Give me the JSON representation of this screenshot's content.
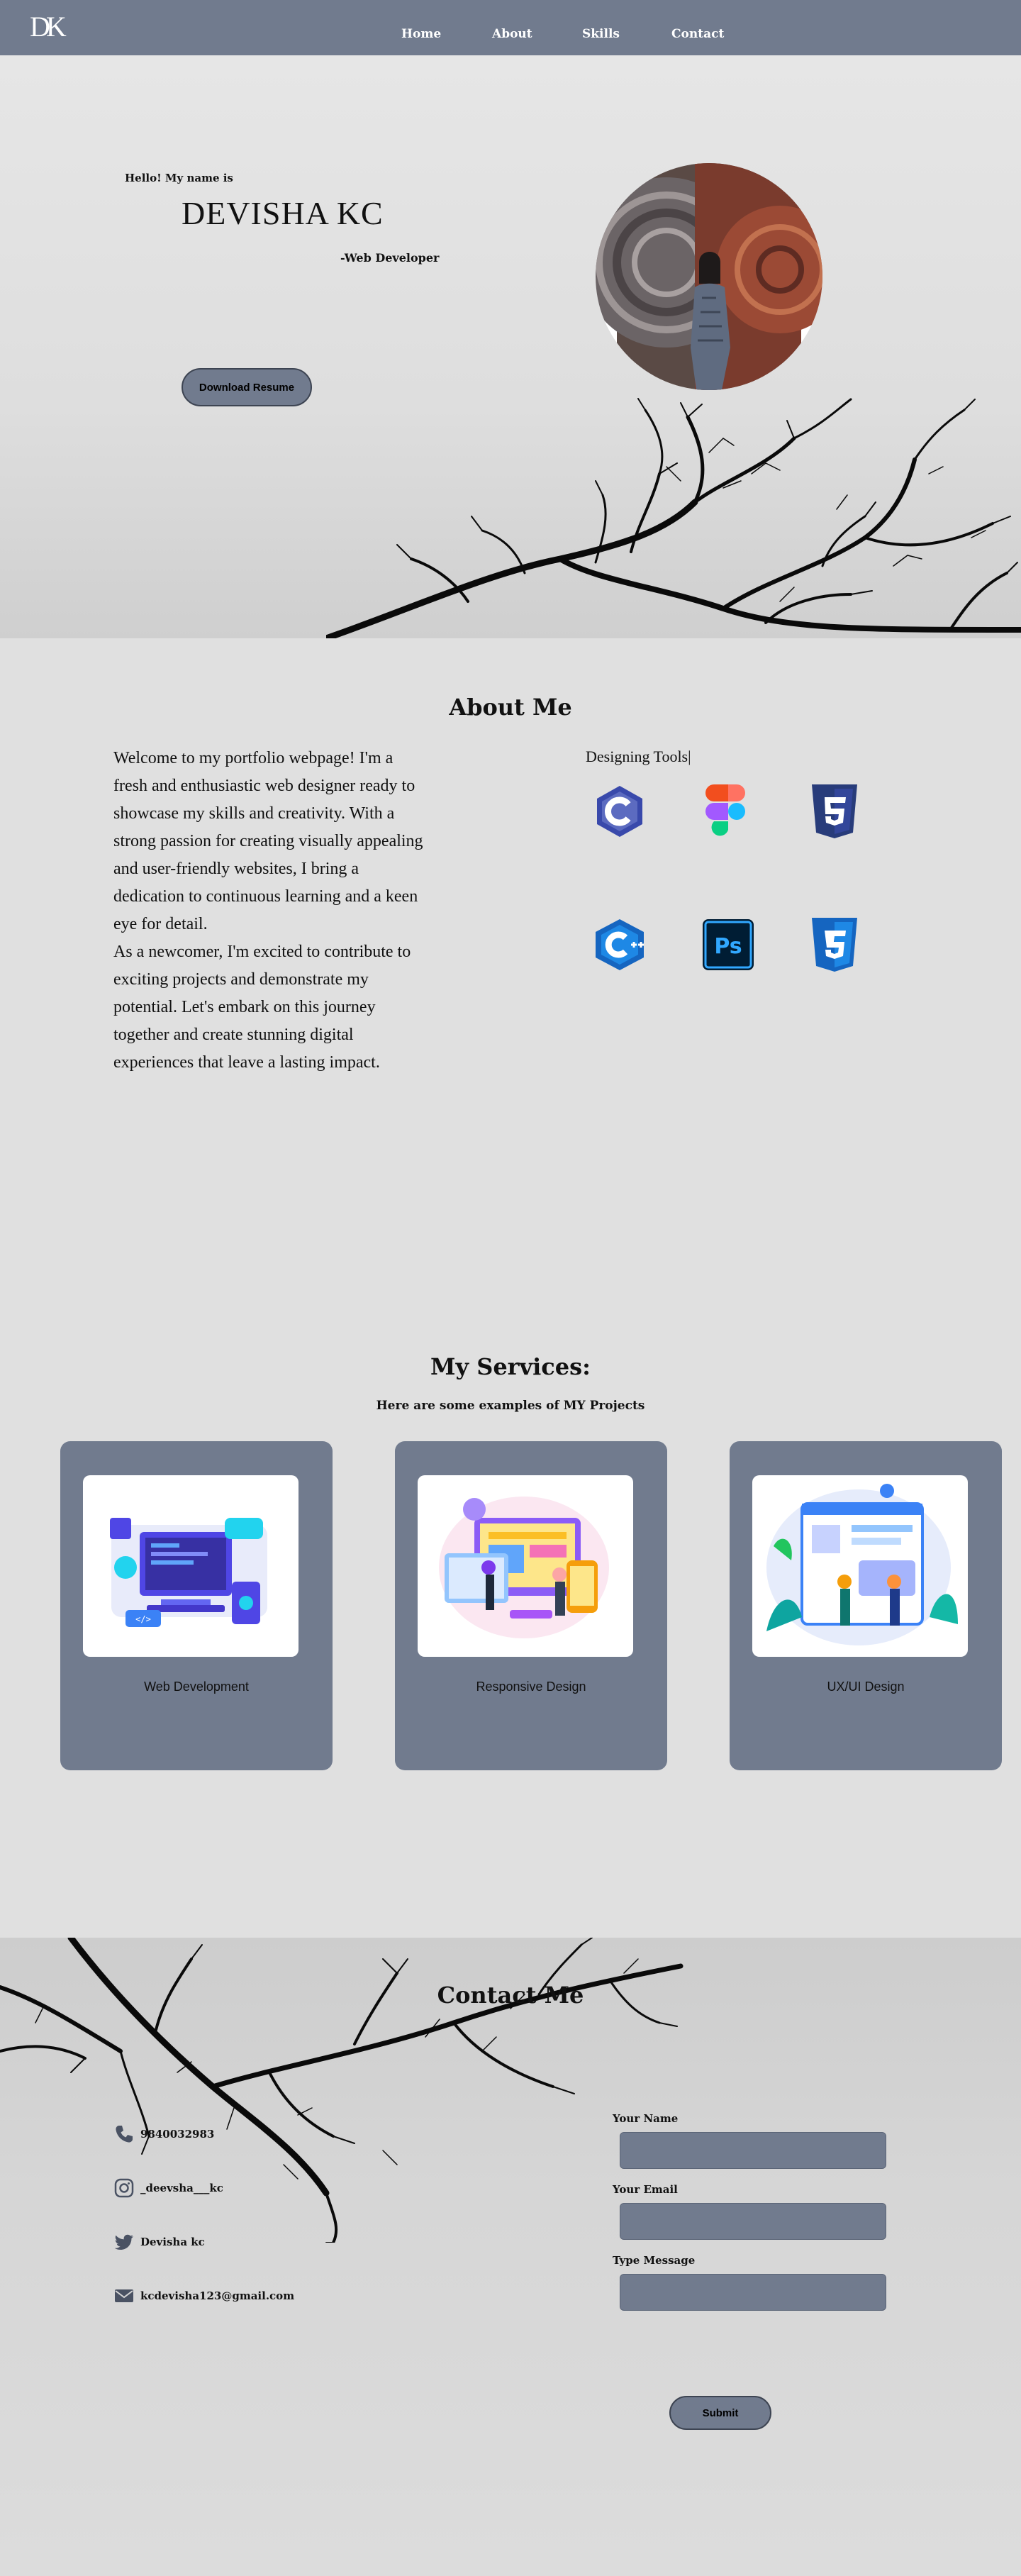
{
  "nav": {
    "logo": "DK",
    "links": [
      "Home",
      "About",
      "Skills",
      "Contact"
    ]
  },
  "hero": {
    "greeting": "Hello! My name is",
    "name": "DEVISHA KC",
    "role": "-Web Developer",
    "download_label": "Download Resume"
  },
  "about": {
    "title": "About Me",
    "paragraphs": [
      "Welcome to my portfolio webpage! I'm a fresh and enthusiastic web designer ready to showcase my skills and creativity. With a strong passion for creating visually appealing and user-friendly websites, I bring a dedication to continuous learning and a keen eye for detail.",
      "As a newcomer, I'm excited to contribute to exciting projects and demonstrate my potential. Let's embark on this journey together and create stunning digital experiences that leave a lasting impact."
    ],
    "tools_label": "Designing Tools|",
    "tools": [
      "c-icon",
      "figma-icon",
      "html5-icon",
      "cpp-icon",
      "photoshop-icon",
      "css3-icon"
    ]
  },
  "services": {
    "title": "My Services:",
    "subtitle": "Here are some examples of MY Projects",
    "cards": [
      {
        "label": "Web Development"
      },
      {
        "label": "Responsive Design"
      },
      {
        "label": "UX/UI Design"
      }
    ]
  },
  "contact": {
    "title": "Contact Me",
    "phone": "9840032983",
    "instagram": "_deevsha___kc",
    "twitter": "Devisha kc",
    "email": "kcdevisha123@gmail.com",
    "fields": {
      "name_label": "Your Name",
      "email_label": "Your Email",
      "message_label": "Type Message"
    },
    "submit_label": "Submit"
  },
  "colors": {
    "accent": "#717b8e",
    "background": "#e0e0e0",
    "text": "#111111"
  }
}
